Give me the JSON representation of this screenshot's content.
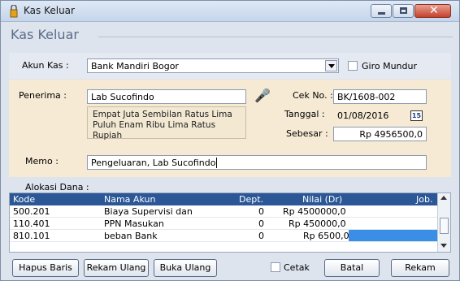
{
  "window": {
    "title": "Kas Keluar"
  },
  "header": {
    "title": "Kas Keluar"
  },
  "akun_kas": {
    "label": "Akun Kas :",
    "value": "Bank Mandiri Bogor"
  },
  "giro_mundur": {
    "label": "Giro Mundur",
    "checked": false
  },
  "penerima": {
    "label": "Penerima :",
    "value": "Lab Sucofindo"
  },
  "terbilang": {
    "line1": "Empat Juta Sembilan Ratus Lima",
    "line2": "Puluh Enam Ribu Lima Ratus Rupiah"
  },
  "cek_no": {
    "label": "Cek No. :",
    "value": "BK/1608-002"
  },
  "tanggal": {
    "label": "Tanggal :",
    "value": "01/08/2016",
    "calendar_text": "15"
  },
  "sebesar": {
    "label": "Sebesar :",
    "value": "Rp 4956500,0"
  },
  "memo": {
    "label": "Memo :",
    "value": "Pengeluaran, Lab Sucofindo"
  },
  "alokasi": {
    "label": "Alokasi Dana :",
    "columns": {
      "kode": "Kode",
      "nama": "Nama Akun",
      "dept": "Dept.",
      "nilai": "Nilai (Dr)",
      "job": "Job."
    },
    "rows": [
      {
        "kode": "500.201",
        "nama": "Biaya Supervisi dan",
        "dept": "0",
        "nilai": "Rp 4500000,0",
        "job": ""
      },
      {
        "kode": "110.401",
        "nama": "PPN Masukan",
        "dept": "0",
        "nilai": "Rp 450000,0",
        "job": ""
      },
      {
        "kode": "810.101",
        "nama": "beban Bank",
        "dept": "0",
        "nilai": "Rp 6500,0",
        "job": ""
      }
    ]
  },
  "buttons": {
    "hapus_baris": "Hapus Baris",
    "rekam_ulang": "Rekam Ulang",
    "buka_ulang": "Buka Ulang",
    "cetak": "Cetak",
    "batal": "Batal",
    "rekam": "Rekam"
  },
  "colors": {
    "grid_header": "#2c5797",
    "selection": "#3a8ee6",
    "payee_panel": "#f6ead4"
  }
}
